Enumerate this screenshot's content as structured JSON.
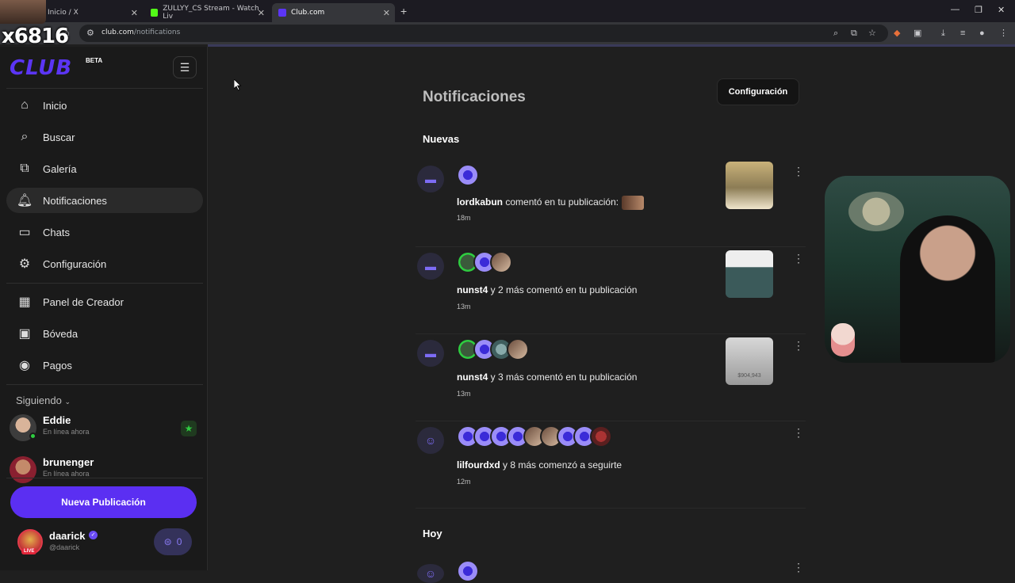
{
  "browser": {
    "tabs": [
      {
        "title": "Inicio / X",
        "active": false
      },
      {
        "title": "ZULLYY_CS Stream - Watch Liv",
        "active": false
      },
      {
        "title": "Club.com",
        "active": true
      }
    ],
    "url_host": "club.com",
    "url_path": "/notifications"
  },
  "overlay": {
    "counter": "x6816"
  },
  "sidebar": {
    "logo": "CLUB",
    "beta": "BETA",
    "nav": [
      {
        "label": "Inicio",
        "icon": "home-icon"
      },
      {
        "label": "Buscar",
        "icon": "search-icon"
      },
      {
        "label": "Galería",
        "icon": "gallery-icon"
      },
      {
        "label": "Notificaciones",
        "icon": "bell-icon",
        "active": true
      },
      {
        "label": "Chats",
        "icon": "chat-icon"
      },
      {
        "label": "Configuración",
        "icon": "gear-icon"
      }
    ],
    "nav2": [
      {
        "label": "Panel de Creador",
        "icon": "dashboard-icon"
      },
      {
        "label": "Bóveda",
        "icon": "vault-icon"
      },
      {
        "label": "Pagos",
        "icon": "payments-icon"
      }
    ],
    "following_label": "Siguiendo",
    "following": [
      {
        "name": "Eddie",
        "status": "En línea ahora"
      },
      {
        "name": "brunenger",
        "status": "En línea ahora"
      }
    ],
    "new_post": "Nueva Publicación",
    "me": {
      "name": "daarick",
      "handle": "@daarick",
      "live": "LIVE",
      "coins": "0"
    }
  },
  "main": {
    "title": "Notificaciones",
    "settings_button": "Configuración",
    "section_new": "Nuevas",
    "section_today": "Hoy",
    "notifications": [
      {
        "user": "lordkabun",
        "rest": " comentó en tu publicación:",
        "time": "18m"
      },
      {
        "user": "nunst4",
        "rest": " y 2 más comentó en tu publicación",
        "time": "13m"
      },
      {
        "user": "nunst4",
        "rest": " y 3 más comentó en tu publicación",
        "time": "13m"
      },
      {
        "user": "lilfourdxd",
        "rest": " y 8 más comenzó a seguirte",
        "time": "12m"
      }
    ],
    "thumb3_text": "$904,943"
  },
  "colors": {
    "accent": "#5b2ff2",
    "bg": "#1f1f1f",
    "sidebar_bg": "#1a1a1a"
  }
}
